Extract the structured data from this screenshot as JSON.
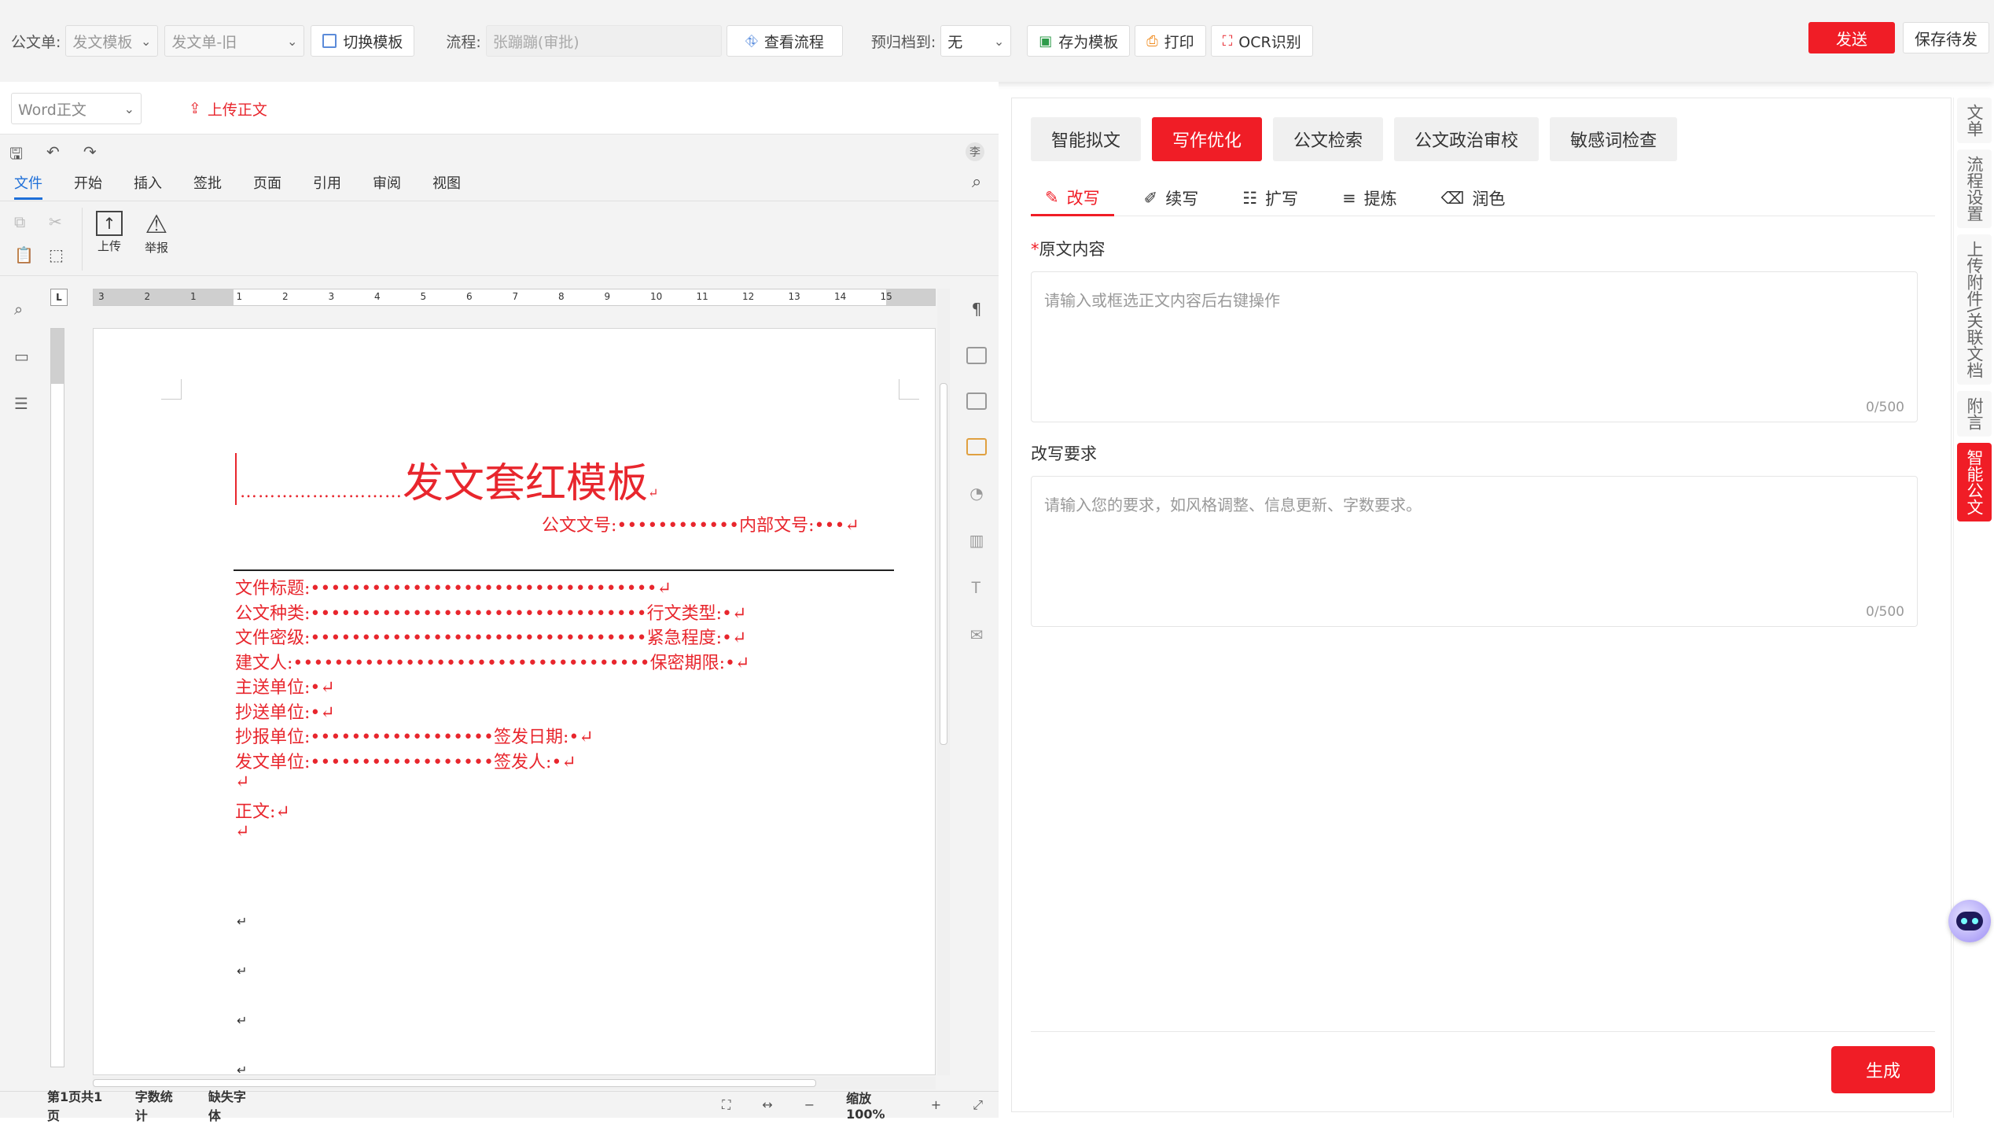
{
  "topbar": {
    "doc_label": "公文单:",
    "doc_template": "发文模板",
    "doc_form": "发文单-旧",
    "switch_template": "切换模板",
    "flow_label": "流程:",
    "flow_value": "张蹦蹦(审批)",
    "view_flow": "查看流程",
    "archive_label": "预归档到:",
    "archive_value": "无",
    "save_as_template": "存为模板",
    "print": "打印",
    "ocr": "OCR识别",
    "send": "发送",
    "save_pending": "保存待发"
  },
  "word": {
    "type_select": "Word正文",
    "upload": "上传正文",
    "menu_tabs": [
      "文件",
      "开始",
      "插入",
      "签批",
      "页面",
      "引用",
      "审阅",
      "视图"
    ],
    "tools": {
      "upload": "上传",
      "report": "举报"
    },
    "avatar": "李",
    "ruler_labels": [
      "3",
      "2",
      "1",
      "1",
      "2",
      "3",
      "4",
      "5",
      "6",
      "7",
      "8",
      "9",
      "10",
      "11",
      "12",
      "13",
      "14",
      "15"
    ],
    "status": {
      "page": "第1页共1页",
      "word_count": "字数统计",
      "missing_font": "缺失字体",
      "zoom": "缩放100%"
    }
  },
  "document": {
    "title": "发文套红模板",
    "number_line": "公文文号:••••••••••••内部文号:•••↵",
    "lines": [
      "文件标题:••••••••••••••••••••••••••••••••••↵",
      "公文种类:•••••••••••••••••••••••••••••••••行文类型:•↵",
      "文件密级:•••••••••••••••••••••••••••••••••紧急程度:•↵",
      "建文人:•••••••••••••••••••••••••••••••••••保密期限:•↵",
      "主送单位:•↵",
      "抄送单位:•↵",
      "抄报单位:••••••••••••••••••签发日期:•↵",
      "发文单位:••••••••••••••••••签发人:•↵",
      "↵",
      "正文:↵",
      "↵"
    ]
  },
  "ai": {
    "tabs": [
      "智能拟文",
      "写作优化",
      "公文检索",
      "公文政治审校",
      "敏感词检查"
    ],
    "active_tab": 1,
    "sub_tabs": [
      "改写",
      "续写",
      "扩写",
      "提炼",
      "润色"
    ],
    "original_label": "原文内容",
    "original_placeholder": "请输入或框选正文内容后右键操作",
    "original_counter": "0/500",
    "require_label": "改写要求",
    "require_placeholder": "请输入您的要求，如风格调整、信息更新、字数要求。",
    "require_counter": "0/500",
    "generate": "生成"
  },
  "right_sidebar": [
    "文单",
    "流程设置",
    "上传附件\\关联文档",
    "附言",
    "智能公文"
  ],
  "colors": {
    "accent": "#f01d26",
    "doc_red": "#e8262d",
    "link_blue": "#1e6fd8"
  }
}
